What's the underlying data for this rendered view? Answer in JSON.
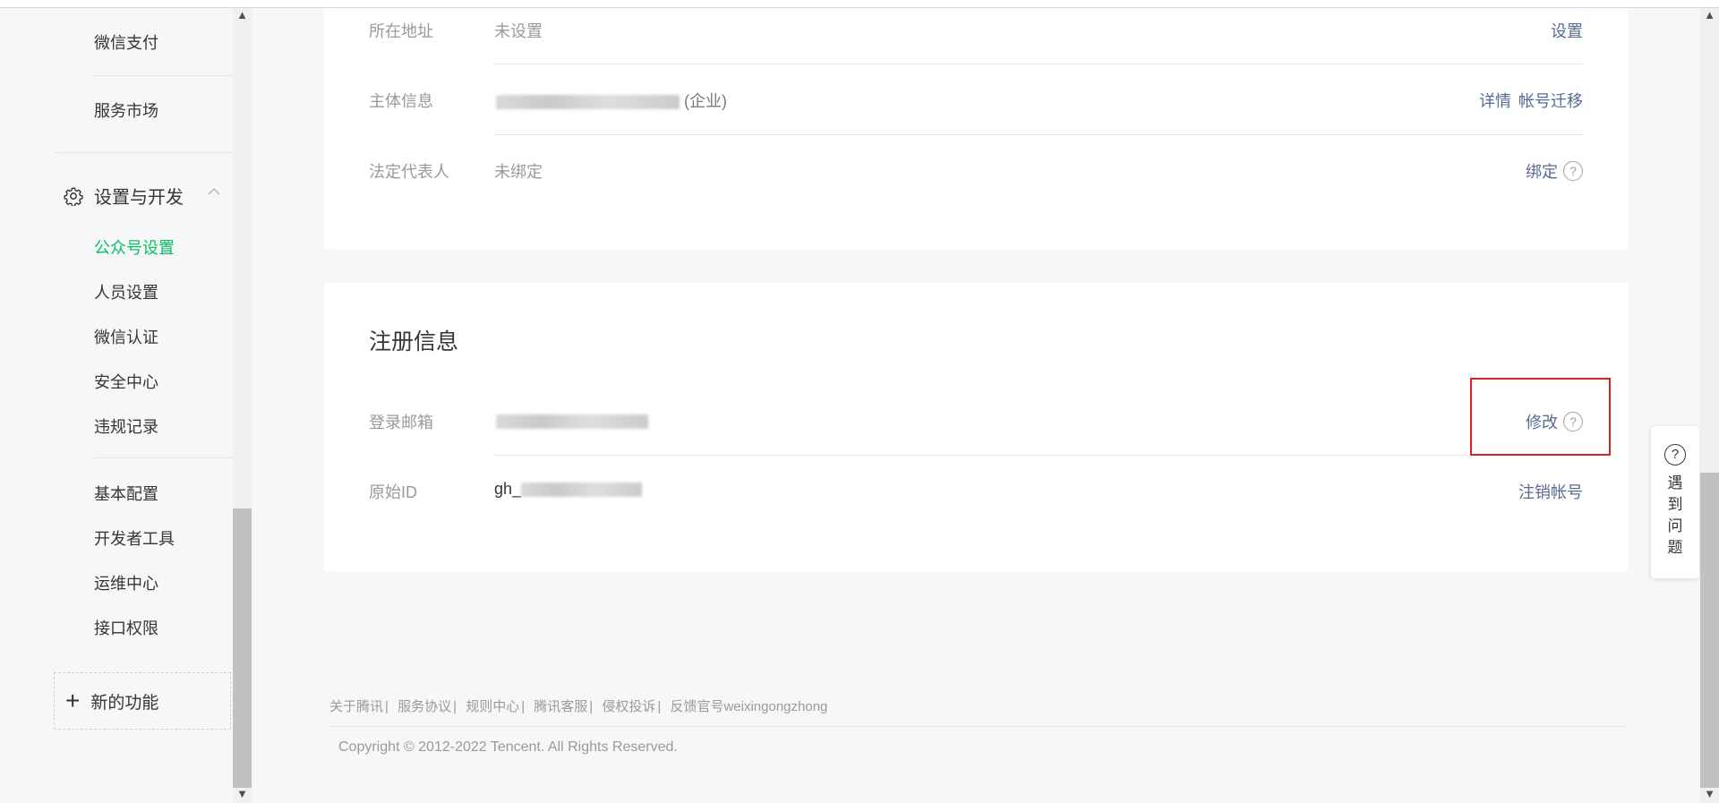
{
  "sidebar": {
    "items_top": [
      "微信支付",
      "服务市场"
    ],
    "section_title": "设置与开发",
    "sub_items": [
      "公众号设置",
      "人员设置",
      "微信认证",
      "安全中心",
      "违规记录"
    ],
    "dev_items": [
      "基本配置",
      "开发者工具",
      "运维中心",
      "接口权限"
    ],
    "new_function": "新的功能"
  },
  "account_card": {
    "rows": [
      {
        "label": "所在地址",
        "value": "未设置",
        "link": "设置"
      },
      {
        "label": "主体信息",
        "value_suffix": "(企业)",
        "link_detail": "详情",
        "link_migrate": "帐号迁移"
      },
      {
        "label": "法定代表人",
        "value": "未绑定",
        "link": "绑定"
      }
    ]
  },
  "register_card": {
    "title": "注册信息",
    "email_label": "登录邮箱",
    "email_link": "修改",
    "id_label": "原始ID",
    "id_prefix": "gh_",
    "id_link": "注销帐号"
  },
  "help_glyph": "?",
  "footer": {
    "links": [
      "关于腾讯",
      "服务协议",
      "规则中心",
      "腾讯客服",
      "侵权投诉",
      "反馈官号weixingongzhong"
    ],
    "separator": "|",
    "copyright": "Copyright © 2012-2022 Tencent. All Rights Reserved."
  },
  "float_help": {
    "icon": "?",
    "text": "遇到问题"
  },
  "colors": {
    "accent": "#07c160",
    "link": "#576b95",
    "highlight": "#e02020"
  }
}
